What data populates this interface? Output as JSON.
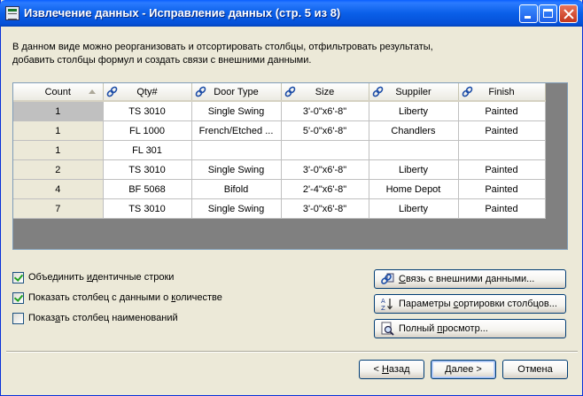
{
  "window": {
    "title": "Извлечение данных - Исправление данных (стр. 5 из 8)"
  },
  "description": {
    "line1": "В данном виде можно реорганизовать и отсортировать столбцы, отфильтровать результаты,",
    "line2": "добавить столбцы формул и создать связи с внешними данными."
  },
  "grid": {
    "columns": [
      {
        "label": "Count",
        "icon": "sort-ascending-icon"
      },
      {
        "label": "Qty#",
        "icon": "link-icon"
      },
      {
        "label": "Door Type",
        "icon": "link-icon"
      },
      {
        "label": "Size",
        "icon": "link-icon"
      },
      {
        "label": "Suppiler",
        "icon": "link-icon"
      },
      {
        "label": "Finish",
        "icon": "link-icon"
      }
    ],
    "rows": [
      [
        "1",
        "TS 3010",
        "Single Swing",
        "3'-0\"x6'-8\"",
        "Liberty",
        "Painted"
      ],
      [
        "1",
        "FL 1000",
        "French/Etched ...",
        "5'-0\"x6'-8\"",
        "Chandlers",
        "Painted"
      ],
      [
        "1",
        "FL 301",
        "",
        "",
        "",
        ""
      ],
      [
        "2",
        "TS 3010",
        "Single Swing",
        "3'-0\"x6'-8\"",
        "Liberty",
        "Painted"
      ],
      [
        "4",
        "BF 5068",
        "Bifold",
        "2'-4\"x6'-8\"",
        "Home Depot",
        "Painted"
      ],
      [
        "7",
        "TS 3010",
        "Single Swing",
        "3'-0\"x6'-8\"",
        "Liberty",
        "Painted"
      ]
    ]
  },
  "options": {
    "combine_rows": {
      "label_pre": "Объединить ",
      "label_u": "и",
      "label_post": "дентичные строки",
      "checked": true
    },
    "show_count": {
      "label_pre": "Показать столбец с данными о ",
      "label_u": "к",
      "label_post": "оличестве",
      "checked": true
    },
    "show_name": {
      "label_pre": "Показ",
      "label_u": "а",
      "label_post": "ть столбец наименований",
      "checked": false
    }
  },
  "buttons": {
    "link_external": {
      "pre": "",
      "u": "С",
      "post": "вязь с внешними данными...",
      "icon": "link-external-icon"
    },
    "sort_columns": {
      "pre": "Параметры ",
      "u": "с",
      "post": "ортировки столбцов...",
      "icon": "sort-az-icon"
    },
    "full_preview": {
      "pre": "Полный ",
      "u": "п",
      "post": "росмотр...",
      "icon": "preview-icon"
    },
    "back": {
      "pre": "< ",
      "u": "Н",
      "post": "азад"
    },
    "next": {
      "pre": "",
      "u": "Д",
      "post": "алее >"
    },
    "cancel": {
      "pre": "",
      "u": "",
      "post": "Отмена"
    }
  }
}
